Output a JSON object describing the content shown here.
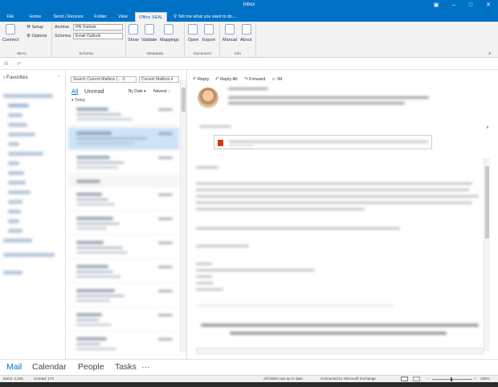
{
  "window": {
    "title": "Inbox",
    "controls": [
      "restore",
      "minimize",
      "maximize",
      "close"
    ]
  },
  "menu": {
    "tabs": [
      "File",
      "Home",
      "Send / Receive",
      "Folder",
      "View",
      "Office SEAL"
    ],
    "active_tab": "Office SEAL",
    "tell_me": "Tell me what you want to do..."
  },
  "ribbon": {
    "connect": "Connect",
    "setup": "Setup",
    "options": "Options",
    "archive_label": "Archive",
    "archive_value": "HN Outlook",
    "schema_label": "Schema",
    "schema_value": "Email Outlook",
    "show": "Show",
    "validate": "Validate",
    "mappings": "Mappings",
    "open": "Open",
    "export": "Export",
    "manual": "Manual",
    "about": "About",
    "groups": [
      "SEAL",
      "Schema",
      "Metadata",
      "Document",
      "Info"
    ]
  },
  "folders": {
    "favorites": "Favorites"
  },
  "list": {
    "search_placeholder": "Search Current Mailbox (...",
    "scope": "Current Mailbox",
    "filter_all": "All",
    "filter_unread": "Unread",
    "sort_by": "By Date",
    "sort_order": "Newest",
    "group_today": "Today"
  },
  "reading": {
    "reply": "Reply",
    "reply_all": "Reply All",
    "forward": "Forward",
    "im": "IM"
  },
  "nav": {
    "items": [
      "Mail",
      "Calendar",
      "People",
      "Tasks",
      "···"
    ],
    "active": "Mail"
  },
  "status": {
    "items": "Items: 2,225",
    "unread": "Unread: 173",
    "sync": "All folders are up to date.",
    "connection": "Connected to: Microsoft Exchange",
    "zoom": "100%"
  },
  "colors": {
    "brand": "#0072c6",
    "selected_row": "#cde3f7"
  }
}
